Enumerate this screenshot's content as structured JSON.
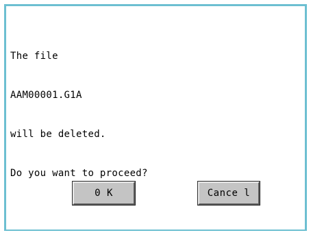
{
  "dialog": {
    "message_lines": [
      "The file",
      "AAM00001.G1A",
      "will be deleted.",
      "Do you want to proceed?"
    ],
    "ok_label": "0 K",
    "cancel_label": "Cance l"
  },
  "colors": {
    "border": "#6cbfd1",
    "button_face": "#c4c4c4"
  }
}
